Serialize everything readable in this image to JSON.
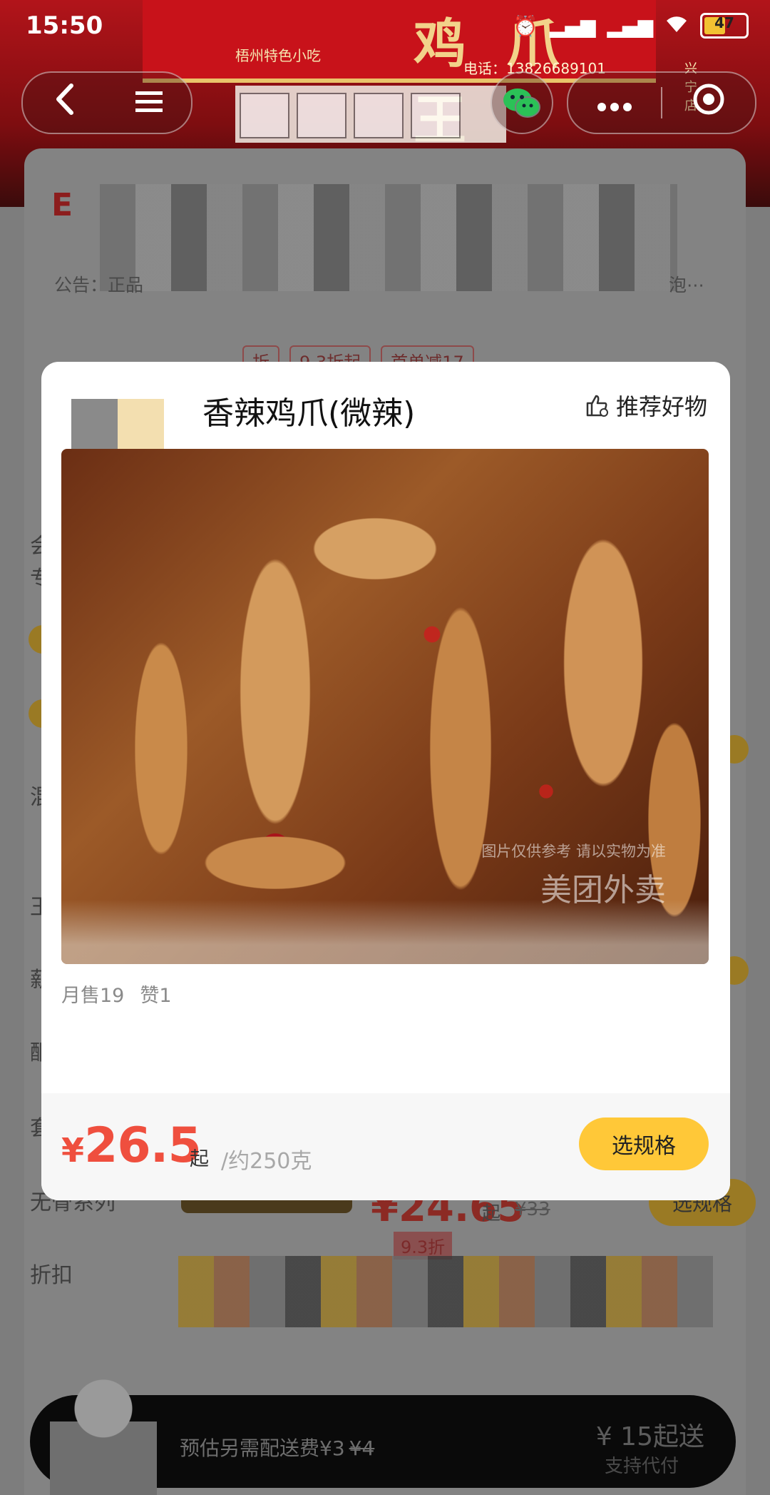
{
  "status_bar": {
    "time": "15:50",
    "battery": "47"
  },
  "shop_banner": {
    "sign": "鸡爪王",
    "subtitle": "梧州特色小吃",
    "phone": "电话：13826689101",
    "branch": "兴宁店"
  },
  "nav": {
    "back_icon": "‹",
    "menu_icon": "☰",
    "more_icon": "•••",
    "target_icon": "◉"
  },
  "store_card": {
    "notice_label": "公告：正品",
    "notice_more": "泡⋯",
    "tags": [
      "折",
      "9.3折起",
      "首单减17"
    ]
  },
  "side_menu": [
    "会",
    "专",
    "混",
    "王",
    "薪",
    "酮",
    "套",
    "无骨系列",
    "折扣"
  ],
  "background_item": {
    "price": "¥24.65",
    "start": "起",
    "old_price": "¥33",
    "spec_button": "选规格",
    "discount_tag": "9.3折"
  },
  "modal": {
    "title": "香辣鸡爪(微辣)",
    "recommend_label": "推荐好物",
    "watermark_line": "图片仅供参考 请以实物为准",
    "watermark_brand": "美团外卖",
    "monthly_sales": "月售19",
    "likes": "赞1",
    "price_symbol": "¥",
    "price_value": "26.5",
    "price_suffix": "起",
    "price_unit": "/约250克",
    "select_spec_label": "选规格"
  },
  "bottom_bar": {
    "delivery_fee": "预估另需配送费¥3",
    "delivery_fee_old": "¥4",
    "min_order": "¥ 15起送",
    "proxy_pay": "支持代付"
  },
  "colors": {
    "accent": "#ffc838",
    "price": "#ef4f3e",
    "bottom_bar": "#0a0a0a"
  }
}
